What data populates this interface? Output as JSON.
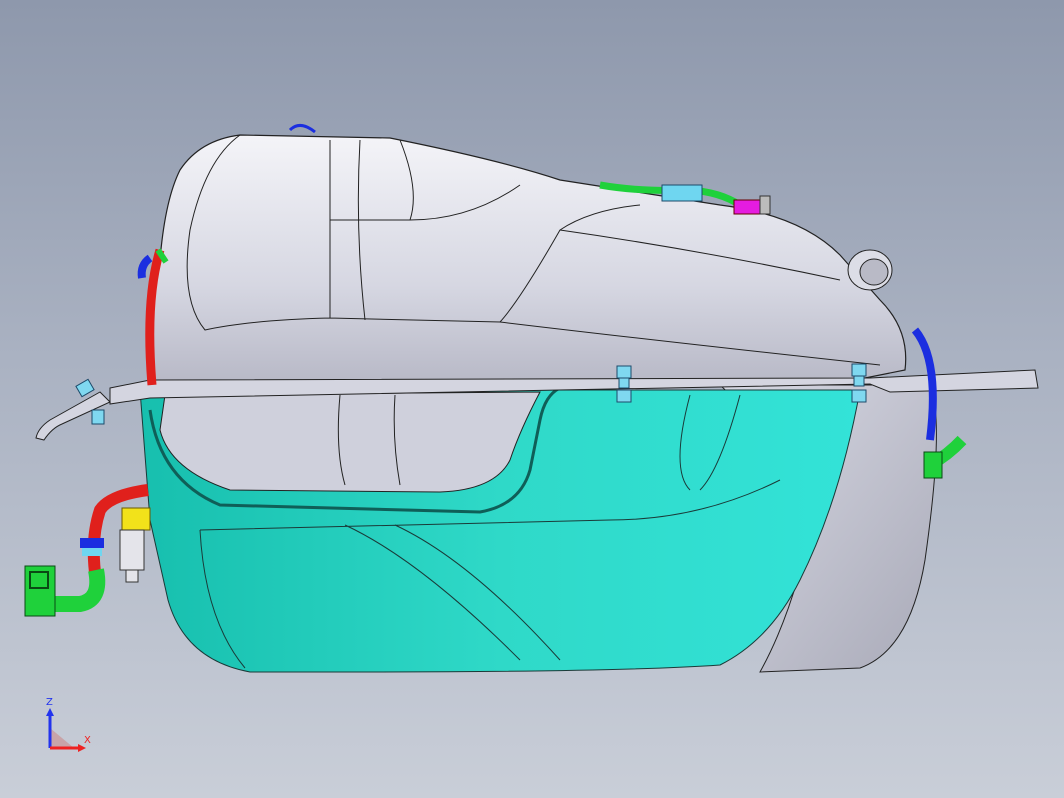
{
  "viewport": {
    "background_top": "#8e98ac",
    "background_bottom": "#c9ced8"
  },
  "model": {
    "upper_shell_color": "#dcdde8",
    "lower_shell_color": "#27d8c8",
    "hose_colors": [
      "#e0201c",
      "#1fd13b",
      "#1b2ee0",
      "#e51ce0",
      "#f2e21a",
      "#6fd6f0"
    ]
  },
  "triad": {
    "z_label": "Z",
    "x_label": "X",
    "z_color": "#2233ee",
    "x_color": "#ee2222"
  }
}
